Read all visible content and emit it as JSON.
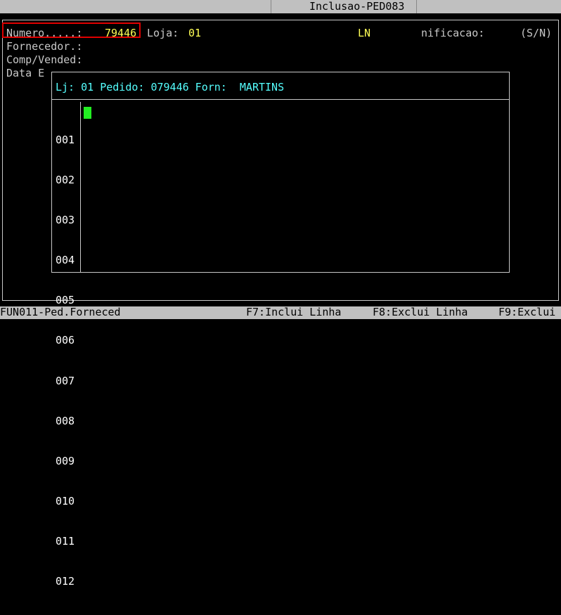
{
  "title": "Inclusao-PED083",
  "form": {
    "numero_label": "Numero.....:",
    "numero_value": "79446",
    "loja_label": "Loja:",
    "loja_value": "01",
    "ln_value": "LN",
    "nificacao_label": "nificacao:",
    "sn_label": "(S/N)",
    "fornecedor_label": "Fornecedor.:",
    "comp_label": "Comp/Vended:",
    "data_label": "Data E"
  },
  "dialog": {
    "header": "Lj: 01 Pedido: 079446 Forn:  MARTINS",
    "line_numbers": [
      "001",
      "002",
      "003",
      "004",
      "005",
      "006",
      "007",
      "008",
      "009",
      "010",
      "011",
      "012"
    ]
  },
  "statusbar": {
    "program": "FUN011-Ped.Forneced",
    "f7": "F7:Inclui Linha",
    "f8": "F8:Exclui Linha",
    "f9": "F9:Exclui"
  }
}
